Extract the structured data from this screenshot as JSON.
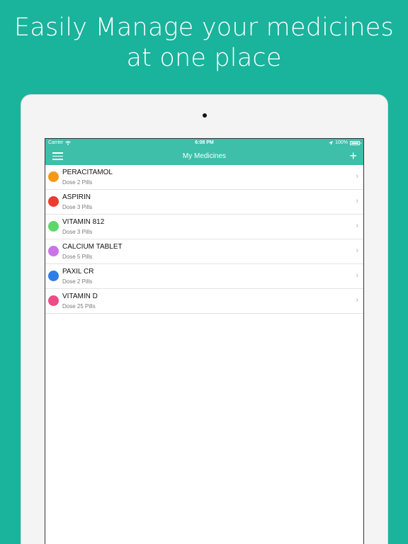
{
  "headline": {
    "line1": "Easily Manage your medicines",
    "line2": "at one place"
  },
  "status_bar": {
    "carrier": "Carrier",
    "time": "6:08 PM",
    "battery": "100%"
  },
  "navbar": {
    "title": "My Medicines"
  },
  "medicines": [
    {
      "name": "PERACITAMOL",
      "dose": "Dose 2 Pills",
      "color": "#f39a1c"
    },
    {
      "name": "ASPIRIN",
      "dose": "Dose 3 Pills",
      "color": "#ee3b32"
    },
    {
      "name": "VITAMIN 812",
      "dose": "Dose 3 Pills",
      "color": "#5fd66b"
    },
    {
      "name": "CALCIUM TABLET",
      "dose": "Dose 5 Pills",
      "color": "#c974e6"
    },
    {
      "name": "PAXIL CR",
      "dose": "Dose 2 Pills",
      "color": "#2f7de9"
    },
    {
      "name": "VITAMIN D",
      "dose": "Dose 25 Pills",
      "color": "#ec4d86"
    }
  ],
  "colors": {
    "background": "#1ab39c",
    "navbar": "#3dbfaa"
  }
}
